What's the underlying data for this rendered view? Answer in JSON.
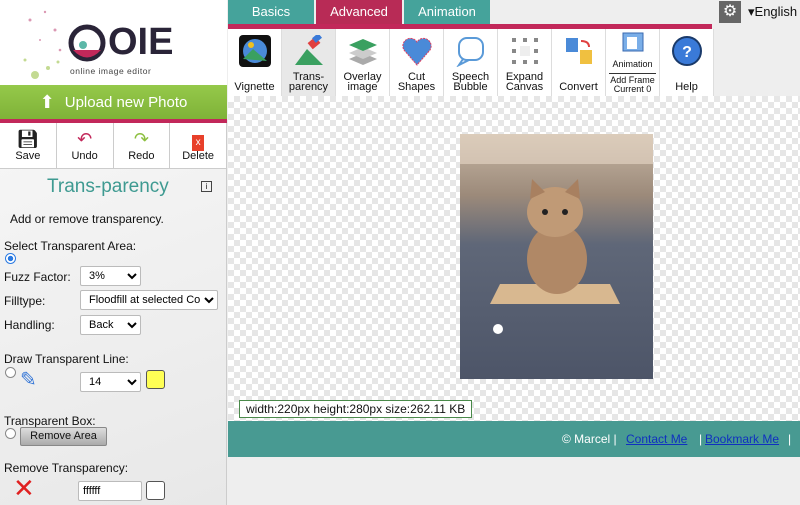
{
  "logo": {
    "letters": "OIE",
    "tagline": "online image editor"
  },
  "sidebar": {
    "upload_label": "Upload new Photo",
    "tools": [
      {
        "label": "Save",
        "icon": "floppy-icon"
      },
      {
        "label": "Undo",
        "icon": "undo-arrow-icon"
      },
      {
        "label": "Redo",
        "icon": "redo-arrow-icon"
      },
      {
        "label": "Delete",
        "icon": "trash-icon"
      }
    ],
    "title": "Trans-parency",
    "info": "i",
    "description": "Add or remove transparency.",
    "select_area_label": "Select Transparent Area:",
    "fuzz_label": "Fuzz Factor:",
    "fuzz_value": "3%",
    "filltype_label": "Filltype:",
    "filltype_value": "Floodfill at selected Colo",
    "handling_label": "Handling:",
    "handling_value": "Back",
    "draw_line_label": "Draw Transparent Line:",
    "line_size": "14",
    "line_color": "#ffff55",
    "box_label": "Transparent Box:",
    "remove_area_label": "Remove Area",
    "remove_transparency_label": "Remove Transparency:",
    "remove_color_value": "ffffff"
  },
  "tabs": [
    {
      "label": "Basics"
    },
    {
      "label": "Advanced",
      "active": true
    },
    {
      "label": "Animation"
    }
  ],
  "language": "▾English",
  "toolbar": [
    {
      "label": "Vignette",
      "icon": "vignette-icon"
    },
    {
      "label": "Trans-\nparency",
      "l1": "Trans-",
      "l2": "parency",
      "icon": "transparency-icon",
      "selected": true
    },
    {
      "l1": "Overlay",
      "l2": "image",
      "icon": "layers-icon"
    },
    {
      "l1": "Cut",
      "l2": "Shapes",
      "icon": "heart-cut-icon"
    },
    {
      "l1": "Speech",
      "l2": "Bubble",
      "icon": "speech-bubble-icon"
    },
    {
      "l1": "Expand",
      "l2": "Canvas",
      "icon": "expand-arrows-icon"
    },
    {
      "label": "Convert",
      "icon": "convert-icon"
    },
    {
      "label": "Animation",
      "l1": "Add Frame",
      "l2": "Current 0",
      "icon": "film-frames-icon"
    },
    {
      "label": "Help",
      "icon": "help-icon"
    }
  ],
  "image_info": "width:220px  height:280px  size:262.11 KB",
  "footer": {
    "copyright": "© Marcel |",
    "contact": "Contact Me",
    "bookmark": "Bookmark Me",
    "sep": "|"
  },
  "colors": {
    "teal": "#45a39b",
    "crimson": "#b82b56",
    "green": "#8cbf3f"
  }
}
